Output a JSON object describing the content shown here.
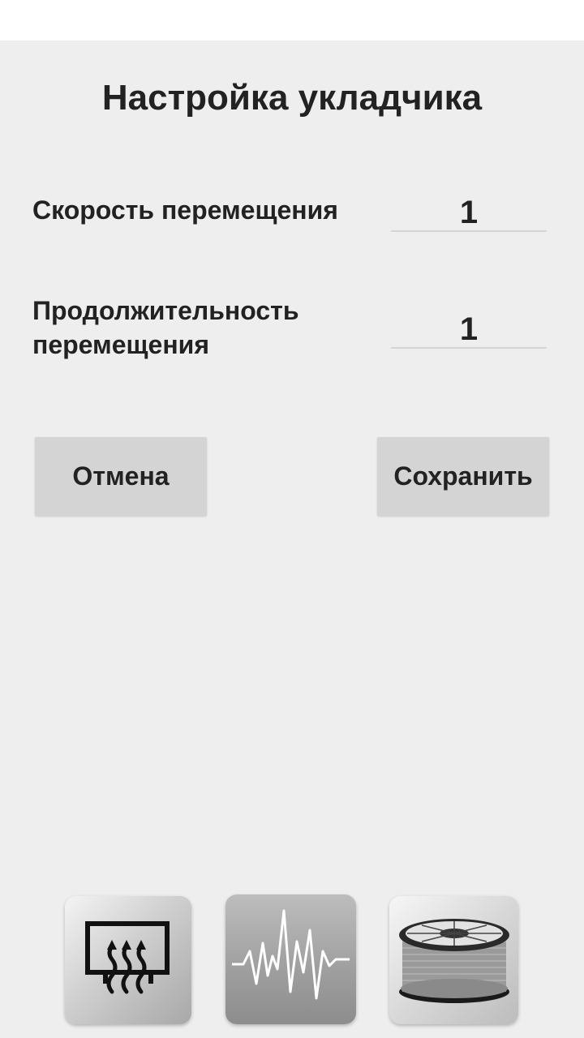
{
  "screen": {
    "title": "Настройка укладчика"
  },
  "fields": {
    "speed": {
      "label": "Скорость перемещения",
      "value": "1"
    },
    "duration": {
      "label": "Продолжительность перемещения",
      "value": "1"
    }
  },
  "buttons": {
    "cancel_label": "Отмена",
    "save_label": "Сохранить"
  },
  "bottom_nav": {
    "items": [
      {
        "icon": "heater-icon"
      },
      {
        "icon": "vibration-wave-icon"
      },
      {
        "icon": "filament-spool-icon"
      }
    ]
  }
}
